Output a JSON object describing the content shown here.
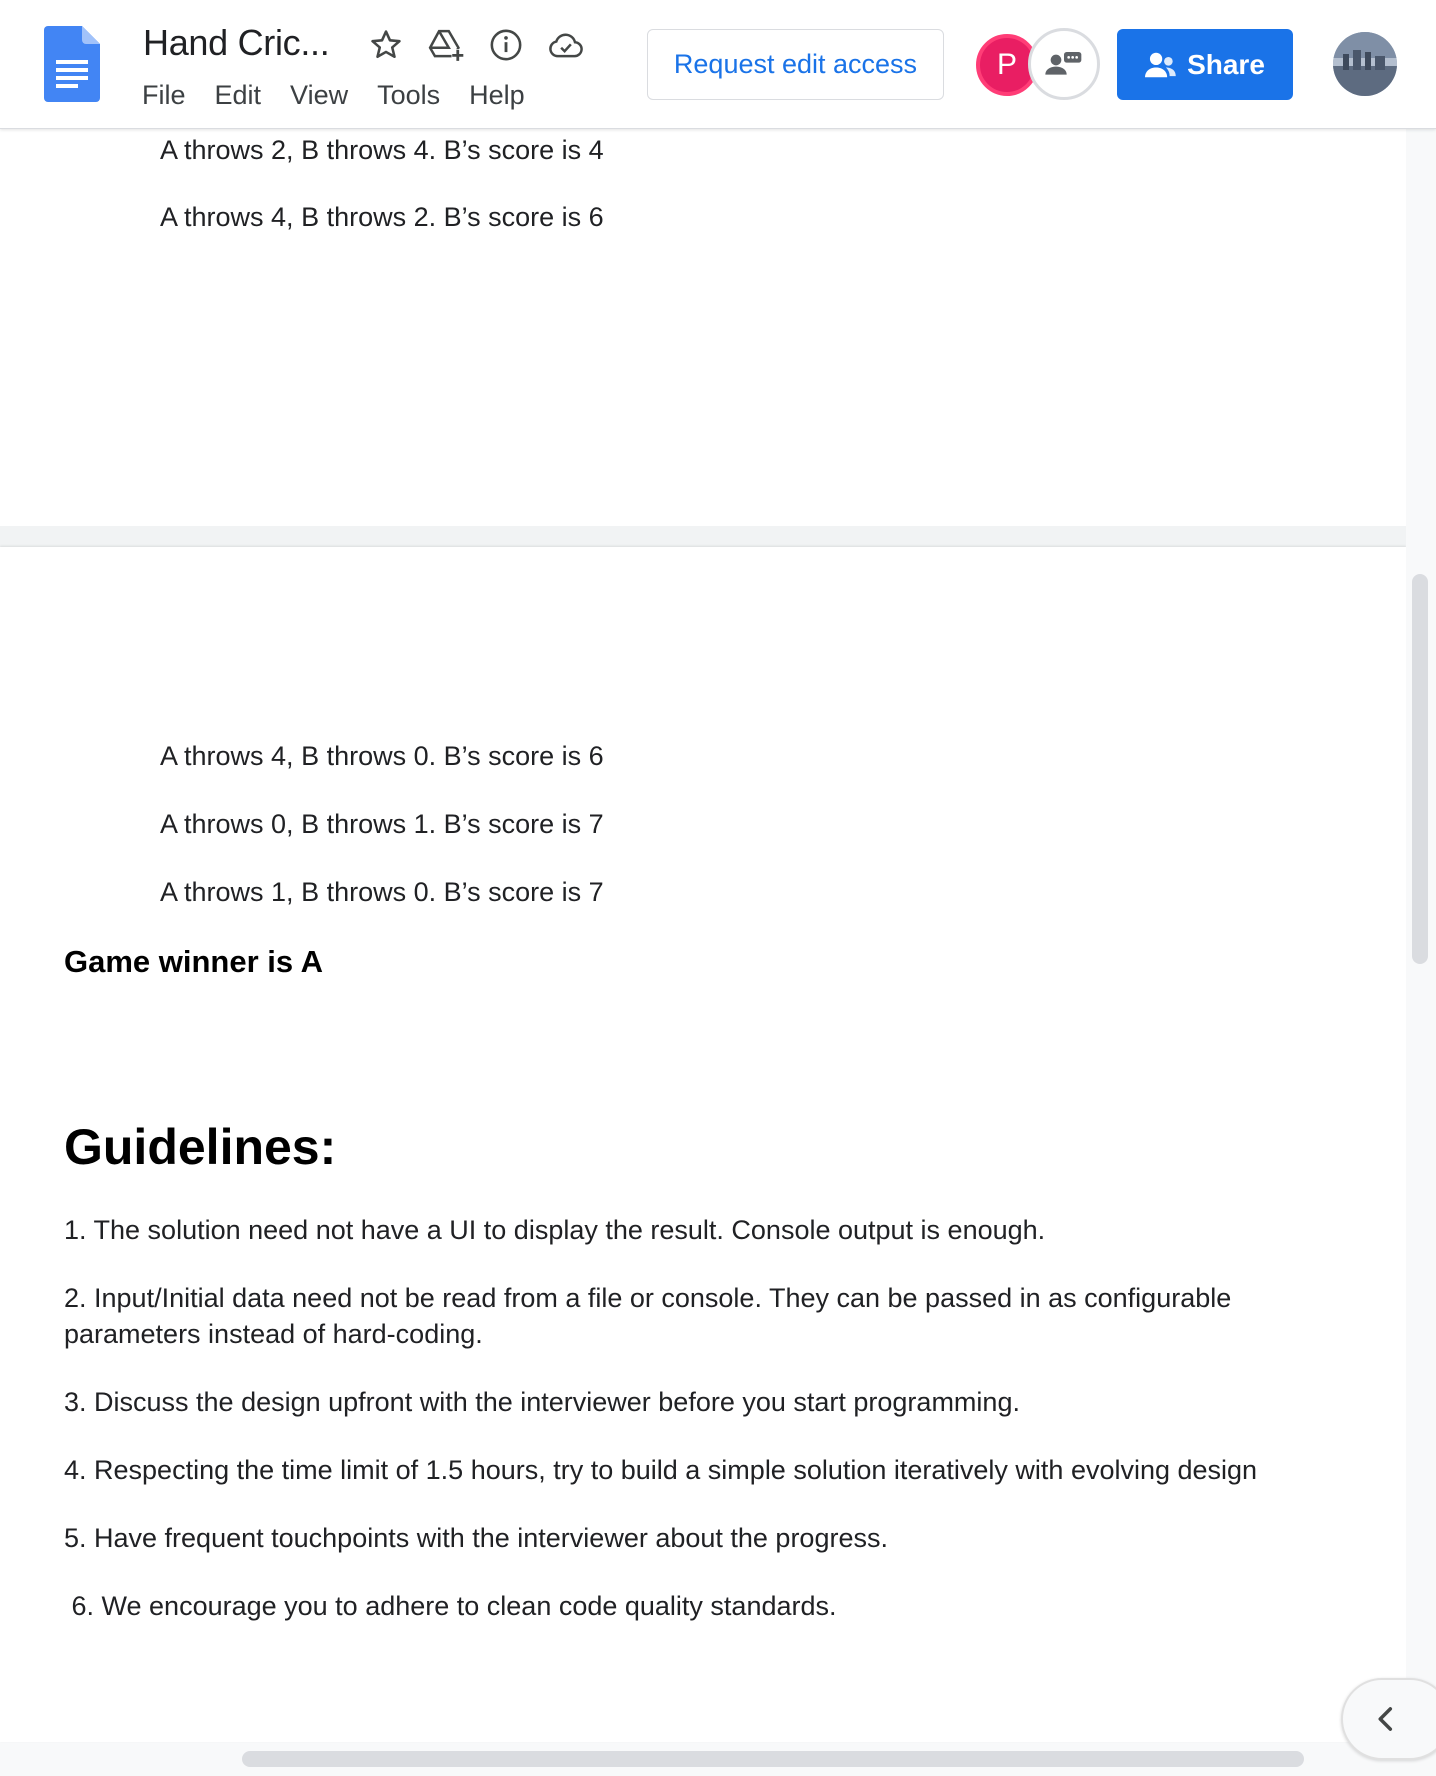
{
  "header": {
    "title": "Hand Cric...",
    "menu": [
      "File",
      "Edit",
      "View",
      "Tools",
      "Help"
    ],
    "request_edit_label": "Request edit access",
    "avatar_initial": "P",
    "share_label": "Share"
  },
  "page1": {
    "lines": [
      "A throws 2, B throws 4. B’s score is 4",
      "A throws 4, B throws 2. B’s score is 6"
    ]
  },
  "page2": {
    "lines": [
      "A throws 4, B throws 0. B’s score is 6",
      "A throws 0, B throws 1. B’s score is 7",
      "A throws 1, B throws 0. B’s score is 7"
    ],
    "winner": "Game winner is A",
    "guidelines_heading": "Guidelines:",
    "guidelines": [
      "1. The solution need not have a UI to display the result. Console output is enough.",
      "2. Input/Initial data need not be read from a file or console. They can be passed in as configurable parameters instead of hard-coding.",
      "3. Discuss the design upfront with the interviewer before you start programming.",
      "4. Respecting the time limit of 1.5 hours, try to build a simple solution iteratively with evolving design",
      "5. Have frequent touchpoints with the interviewer about the progress.",
      " 6. We encourage you to adhere to clean code quality standards."
    ]
  },
  "icons": {
    "docs_logo": "google-docs-icon",
    "star": "star-icon",
    "drive": "add-to-drive-icon",
    "info": "info-icon",
    "cloud": "cloud-saved-icon",
    "group": "group-chat-icon",
    "share": "person-add-icon",
    "collapse": "chevron-left-icon"
  },
  "colors": {
    "accent": "#1a73e8",
    "avatar": "#e91e63"
  }
}
